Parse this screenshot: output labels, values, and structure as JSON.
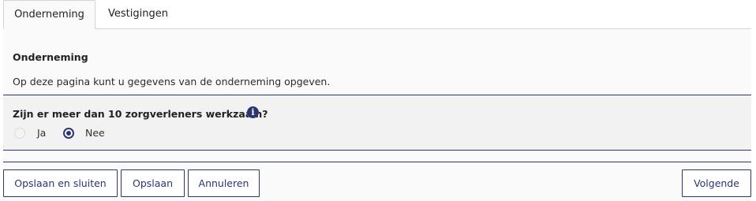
{
  "tabs": [
    {
      "label": "Onderneming",
      "active": true
    },
    {
      "label": "Vestigingen",
      "active": false
    }
  ],
  "section": {
    "title": "Onderneming",
    "description": "Op deze pagina kunt u gegevens van de onderneming opgeven."
  },
  "question": {
    "label": "Zijn er meer dan 10 zorgverleners werkzaam?",
    "info_icon": "info-icon",
    "options": [
      {
        "label": "Ja",
        "selected": false
      },
      {
        "label": "Nee",
        "selected": true
      }
    ]
  },
  "buttons": {
    "save_close": "Opslaan en sluiten",
    "save": "Opslaan",
    "cancel": "Annuleren",
    "next": "Volgende"
  },
  "colors": {
    "accent": "#2b3572",
    "panel_bg": "#fafafa",
    "question_bg": "#f2f2f2"
  }
}
